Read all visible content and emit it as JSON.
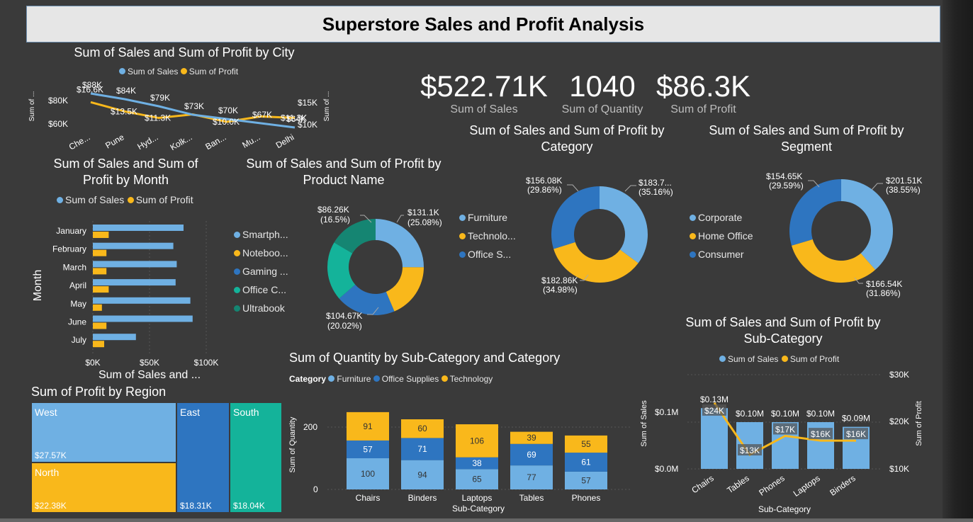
{
  "header": {
    "title": "Superstore Sales and Profit Analysis"
  },
  "colors": {
    "sales": "#6fb0e3",
    "profit": "#f9b81b",
    "furniture": "#6fb0e3",
    "office": "#2e75c0",
    "tech": "#f9b81b",
    "teal": "#14b39a",
    "darkteal": "#158572"
  },
  "kpis": [
    {
      "value": "$522.71K",
      "label": "Sum of Sales"
    },
    {
      "value": "1040",
      "label": "Sum of Quantity"
    },
    {
      "value": "$86.3K",
      "label": "Sum of Profit"
    }
  ],
  "city_chart": {
    "title": "Sum of Sales and Sum of Profit by City",
    "legend": [
      "Sum of Sales",
      "Sum of Profit"
    ],
    "y_left_label": "Sum of ...",
    "y_right_label": "Sum of ...",
    "y_left_ticks": [
      "$80K",
      "$60K"
    ],
    "y_right_ticks": [
      "$15K",
      "$10K"
    ],
    "categories": [
      "Che...",
      "Pune",
      "Hyd...",
      "Kolk...",
      "Ban...",
      "Mu...",
      "Delhi"
    ],
    "sales_labels": [
      "$88K",
      "$84K",
      "$79K",
      "$73K",
      "$70K",
      "$67K",
      "$64K"
    ],
    "profit_labels": [
      "$16.6K",
      "$13.5K",
      "$11.3K",
      "",
      "$10.0K",
      "",
      "$11.3K"
    ]
  },
  "month_chart": {
    "title_line1": "Sum of Sales and Sum of",
    "title_line2": "Profit by Month",
    "legend": [
      "Sum of Sales",
      "Sum of Profit"
    ],
    "y_label": "Month",
    "x_label": "Sum of Sales and ...",
    "x_ticks": [
      "$0K",
      "$50K",
      "$100K"
    ],
    "months": [
      "January",
      "February",
      "March",
      "April",
      "May",
      "June",
      "July"
    ]
  },
  "product_chart": {
    "title_line1": "Sum of Sales and Sum of Profit by",
    "title_line2": "Product Name",
    "legend": [
      "Smartph...",
      "Noteboo...",
      "Gaming ...",
      "Office C...",
      "Ultrabook"
    ],
    "labels": [
      {
        "v": "$131.1K",
        "p": "(25.08%)"
      },
      {
        "v": "$104.67K",
        "p": "(20.02%)"
      },
      {
        "v": "$86.26K",
        "p": "(16.5%)"
      }
    ]
  },
  "category_chart": {
    "title_line1": "Sum of Sales and Sum of Profit by",
    "title_line2": "Category",
    "legend": [
      "Furniture",
      "Technolo...",
      "Office S..."
    ],
    "labels": [
      {
        "v": "$183.7...",
        "p": "(35.16%)"
      },
      {
        "v": "$182.86K",
        "p": "(34.98%)"
      },
      {
        "v": "$156.08K",
        "p": "(29.86%)"
      }
    ]
  },
  "segment_chart": {
    "title_line1": "Sum of Sales and Sum of Profit by",
    "title_line2": "Segment",
    "legend": [
      "Corporate",
      "Home Office",
      "Consumer"
    ],
    "labels": [
      {
        "v": "$201.51K",
        "p": "(38.55%)"
      },
      {
        "v": "$166.54K",
        "p": "(31.86%)"
      },
      {
        "v": "$154.65K",
        "p": "(29.59%)"
      }
    ]
  },
  "region_chart": {
    "title": "Sum of Profit by Region",
    "regions": [
      {
        "name": "West",
        "value": "$27.57K"
      },
      {
        "name": "North",
        "value": "$22.38K"
      },
      {
        "name": "East",
        "value": "$18.31K"
      },
      {
        "name": "South",
        "value": "$18.04K"
      }
    ]
  },
  "quantity_chart": {
    "title": "Sum of Quantity by Sub-Category and Category",
    "legend_title": "Category",
    "legend": [
      "Furniture",
      "Office Supplies",
      "Technology"
    ],
    "y_label": "Sum of Quantity",
    "x_label": "Sub-Category",
    "y_ticks": [
      "200",
      "0"
    ]
  },
  "subcat_chart": {
    "title_line1": "Sum of Sales and Sum of Profit by",
    "title_line2": "Sub-Category",
    "legend": [
      "Sum of Sales",
      "Sum of Profit"
    ],
    "y_left_label": "Sum of Sales",
    "y_right_label": "Sum of Profit",
    "x_label": "Sub-Category",
    "y_left_ticks": [
      "$0.1M",
      "$0.0M"
    ],
    "y_right_ticks": [
      "$30K",
      "$20K",
      "$10K"
    ],
    "sales_labels": [
      "$0.13M",
      "$0.10M",
      "$0.10M",
      "$0.10M",
      "$0.09M"
    ],
    "profit_labels": [
      "$24K",
      "$13K",
      "$17K",
      "$16K",
      "$16K"
    ]
  },
  "chart_data": [
    {
      "type": "line",
      "title": "Sum of Sales and Sum of Profit by City",
      "x": [
        "Che...",
        "Pune",
        "Hyd...",
        "Kolk...",
        "Ban...",
        "Mu...",
        "Delhi"
      ],
      "series": [
        {
          "name": "Sum of Sales",
          "values": [
            88,
            84,
            79,
            73,
            70,
            67,
            64
          ]
        },
        {
          "name": "Sum of Profit",
          "values": [
            16.6,
            13.5,
            11.3,
            12.5,
            10.0,
            11.8,
            11.3
          ]
        }
      ]
    },
    {
      "type": "bar",
      "title": "Sum of Sales and Sum of Profit by Month",
      "categories": [
        "January",
        "February",
        "March",
        "April",
        "May",
        "June",
        "July"
      ],
      "series": [
        {
          "name": "Sum of Sales",
          "values": [
            80,
            71,
            74,
            73,
            86,
            88,
            38
          ]
        },
        {
          "name": "Sum of Profit",
          "values": [
            14,
            12,
            12,
            14,
            8,
            12,
            10
          ]
        }
      ],
      "xlim": [
        0,
        100
      ]
    },
    {
      "type": "pie",
      "title": "Sum of Sales and Sum of Profit by Product Name",
      "categories": [
        "Smartph...",
        "Noteboo...",
        "Gaming ...",
        "Office C...",
        "Ultrabook"
      ],
      "values": [
        131.1,
        97.0,
        104.67,
        103.68,
        86.26
      ]
    },
    {
      "type": "pie",
      "title": "Sum of Sales and Sum of Profit by Category",
      "categories": [
        "Furniture",
        "Technolo...",
        "Office S..."
      ],
      "values": [
        183.77,
        182.86,
        156.08
      ]
    },
    {
      "type": "pie",
      "title": "Sum of Sales and Sum of Profit by Segment",
      "categories": [
        "Corporate",
        "Home Office",
        "Consumer"
      ],
      "values": [
        201.51,
        166.54,
        154.65
      ]
    },
    {
      "type": "bar",
      "title": "Sum of Quantity by Sub-Category and Category",
      "categories": [
        "Chairs",
        "Binders",
        "Laptops",
        "Tables",
        "Phones"
      ],
      "series": [
        {
          "name": "Furniture",
          "values": [
            100,
            94,
            65,
            77,
            57
          ]
        },
        {
          "name": "Office Supplies",
          "values": [
            57,
            71,
            38,
            69,
            61
          ]
        },
        {
          "name": "Technology",
          "values": [
            91,
            60,
            106,
            39,
            55
          ]
        }
      ]
    },
    {
      "type": "bar",
      "title": "Sum of Sales and Sum of Profit by Sub-Category",
      "categories": [
        "Chairs",
        "Tables",
        "Phones",
        "Laptops",
        "Binders"
      ],
      "series": [
        {
          "name": "Sum of Sales",
          "values": [
            0.13,
            0.1,
            0.1,
            0.1,
            0.09
          ]
        },
        {
          "name": "Sum of Profit",
          "values": [
            24,
            13,
            17,
            16,
            16
          ]
        }
      ]
    },
    {
      "type": "table",
      "title": "Sum of Profit by Region",
      "categories": [
        "West",
        "North",
        "East",
        "South"
      ],
      "values": [
        27.57,
        22.38,
        18.31,
        18.04
      ]
    }
  ]
}
